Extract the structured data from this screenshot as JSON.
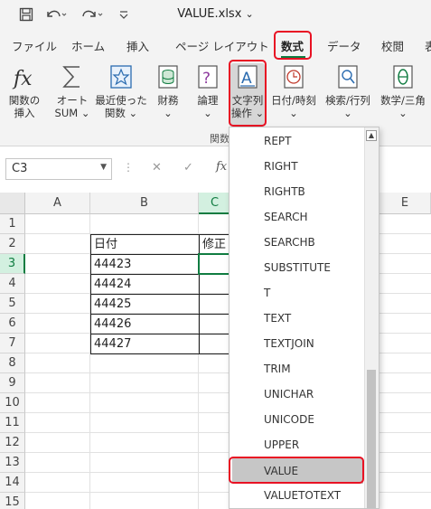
{
  "title_bar": {
    "title": "VALUE.xlsx",
    "title_caret": "⌄",
    "save_icon": "save-icon",
    "undo_icon": "undo-icon",
    "redo_icon": "redo-icon",
    "customize_icon": "customize-quick-access-icon"
  },
  "ribbon_tabs": [
    {
      "label": "ファイル"
    },
    {
      "label": "ホーム"
    },
    {
      "label": "挿入"
    },
    {
      "label": "ページ レイアウト"
    },
    {
      "label": "数式",
      "active": true
    },
    {
      "label": "データ"
    },
    {
      "label": "校閲"
    },
    {
      "label": "表"
    }
  ],
  "ribbon": {
    "buttons": [
      {
        "line1": "関数の",
        "line2": "挿入",
        "icon": "function-fx-icon"
      },
      {
        "line1": "オート",
        "line2": "SUM ⌄",
        "icon": "sigma-icon"
      },
      {
        "line1": "最近使った",
        "line2": "関数 ⌄",
        "icon": "star-icon"
      },
      {
        "line1": "財務",
        "line2": "⌄",
        "icon": "finance-icon"
      },
      {
        "line1": "論理",
        "line2": "⌄",
        "icon": "logical-icon"
      },
      {
        "line1": "文字列",
        "line2": "操作 ⌄",
        "icon": "text-icon"
      },
      {
        "line1": "日付/時刻",
        "line2": "⌄",
        "icon": "clock-icon"
      },
      {
        "line1": "検索/行列",
        "line2": "⌄",
        "icon": "lookup-icon"
      },
      {
        "line1": "数学/三角",
        "line2": "⌄",
        "icon": "math-icon"
      }
    ],
    "group_label": "関数"
  },
  "formula_bar": {
    "name_box": "C3",
    "cancel_symbol": "✕",
    "enter_symbol": "✓",
    "fx_symbol": "fx"
  },
  "sheet": {
    "columns": [
      "A",
      "B",
      "C",
      "E"
    ],
    "rows": [
      "1",
      "2",
      "3",
      "4",
      "5",
      "6",
      "7",
      "8",
      "9",
      "10",
      "11",
      "12",
      "13",
      "14",
      "15"
    ],
    "header_b": "日付",
    "header_c": "修正",
    "values": [
      "44423",
      "44424",
      "44425",
      "44426",
      "44427"
    ],
    "active_cell": "C3"
  },
  "dropdown": {
    "items": [
      "REPT",
      "RIGHT",
      "RIGHTB",
      "SEARCH",
      "SEARCHB",
      "SUBSTITUTE",
      "T",
      "TEXT",
      "TEXTJOIN",
      "TRIM",
      "UNICHAR",
      "UNICODE",
      "UPPER",
      "VALUE",
      "VALUETOTEXT"
    ],
    "highlighted": "VALUE",
    "scroll_up": "▲"
  },
  "colors": {
    "accent_green": "#107c41",
    "highlight_red": "#e81123",
    "ribbon_bg": "#f3f3f3"
  }
}
